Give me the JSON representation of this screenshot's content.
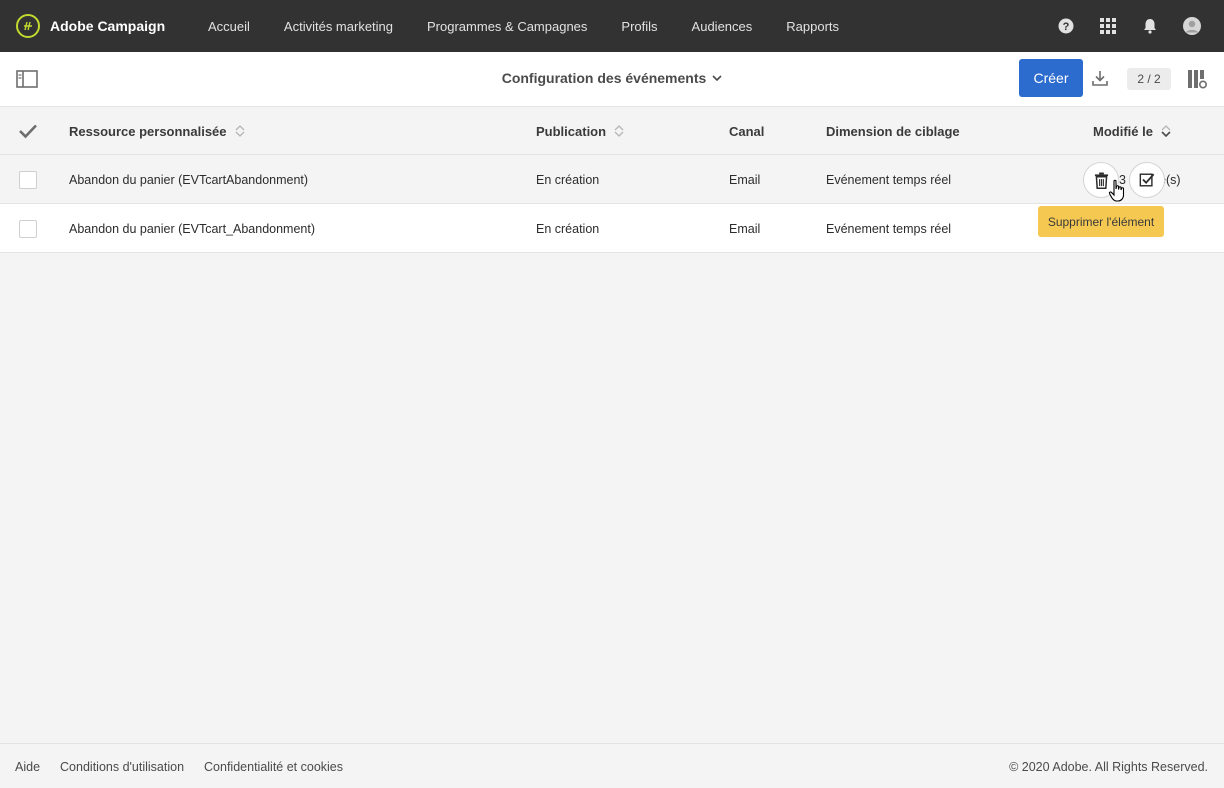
{
  "app": {
    "name": "Adobe Campaign"
  },
  "nav": {
    "items": [
      "Accueil",
      "Activités marketing",
      "Programmes & Campagnes",
      "Profils",
      "Audiences",
      "Rapports"
    ]
  },
  "top_icons": [
    "help-icon",
    "apps-grid-icon",
    "bell-icon",
    "user-avatar-icon"
  ],
  "toolbar": {
    "title": "Configuration des événements",
    "create_label": "Créer",
    "count": "2 / 2"
  },
  "table": {
    "columns": [
      "Ressource personnalisée",
      "Publication",
      "Canal",
      "Dimension de ciblage",
      "Modifié le"
    ],
    "rows": [
      {
        "resource": "Abandon du panier (EVTcartAbandonment)",
        "publication": "En création",
        "canal": "Email",
        "dimension": "Evénement temps réel",
        "modified_fragment_start": "3",
        "modified_fragment_end": "e(s)"
      },
      {
        "resource": "Abandon du panier (EVTcart_Abandonment)",
        "publication": "En création",
        "canal": "Email",
        "dimension": "Evénement temps réel"
      }
    ]
  },
  "tooltip": {
    "text": "Supprimer l'élément"
  },
  "footer": {
    "links": [
      "Aide",
      "Conditions d'utilisation",
      "Confidentialité et cookies"
    ],
    "copyright": "© 2020 Adobe. All Rights Reserved."
  },
  "colors": {
    "topbar": "#323232",
    "primary_button": "#2d6ccf",
    "tooltip": "#f5c851",
    "brand_accent": "#c2d92f"
  }
}
